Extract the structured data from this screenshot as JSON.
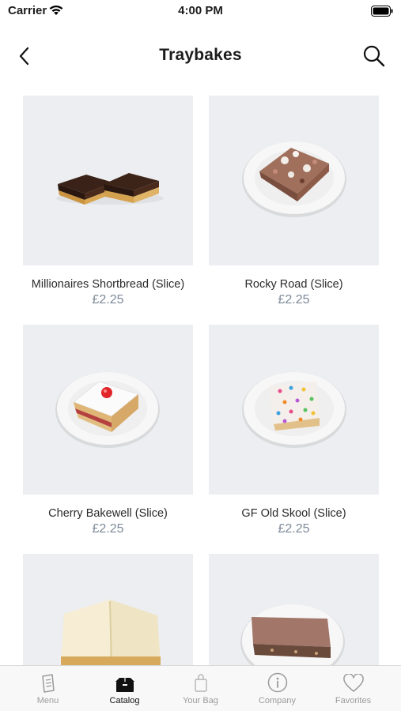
{
  "status_bar": {
    "carrier": "Carrier",
    "time": "4:00 PM"
  },
  "nav": {
    "title": "Traybakes"
  },
  "products": [
    {
      "name": "Millionaires Shortbread (Slice)",
      "price": "£2.25",
      "image": "millionaires-shortbread-photo"
    },
    {
      "name": "Rocky Road (Slice)",
      "price": "£2.25",
      "image": "rocky-road-photo"
    },
    {
      "name": "Cherry Bakewell (Slice)",
      "price": "£2.25",
      "image": "cherry-bakewell-photo"
    },
    {
      "name": "GF Old Skool (Slice)",
      "price": "£2.25",
      "image": "gf-old-skool-photo"
    },
    {
      "name": "",
      "price": "",
      "image": "white-chocolate-slice-photo"
    },
    {
      "name": "",
      "price": "",
      "image": "chocolate-traybake-photo"
    }
  ],
  "tabs": [
    {
      "label": "Menu",
      "icon": "menu-icon",
      "active": false
    },
    {
      "label": "Catalog",
      "icon": "catalog-icon",
      "active": true
    },
    {
      "label": "Your Bag",
      "icon": "bag-icon",
      "active": false
    },
    {
      "label": "Company",
      "icon": "info-icon",
      "active": false
    },
    {
      "label": "Favorites",
      "icon": "heart-icon",
      "active": false
    }
  ],
  "colors": {
    "price": "#7d8a99",
    "image_bg": "#eceef1",
    "tab_inactive": "#9b9b9b",
    "tab_active": "#111111"
  }
}
